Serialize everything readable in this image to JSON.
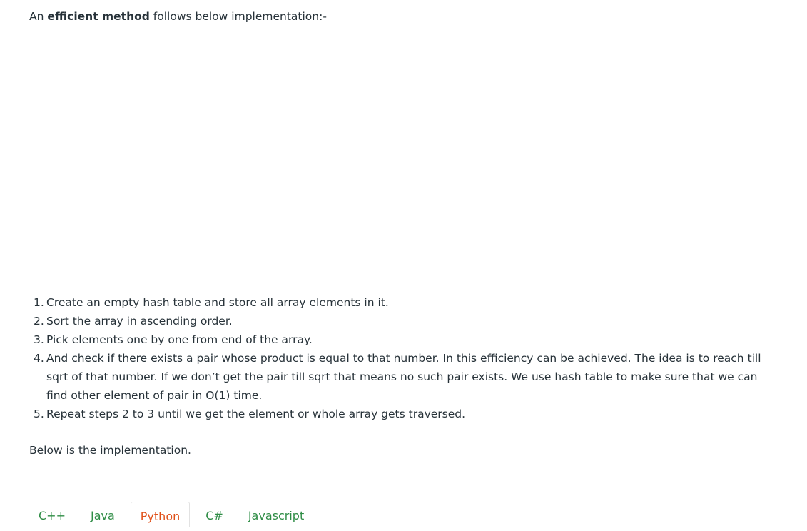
{
  "intro": {
    "prefix": "An ",
    "bold": "efficient method",
    "suffix": " follows below implementation:-"
  },
  "steps": [
    {
      "num": "1.",
      "text": "Create an empty hash table and store all array elements in it."
    },
    {
      "num": "2.",
      "text": "Sort the array in ascending order."
    },
    {
      "num": "3.",
      "text": "Pick elements one by one from end of the array."
    },
    {
      "num": "4.",
      "text": "And check if there exists a pair whose product is equal to that number. In this efficiency can be achieved. The idea is to reach till sqrt of that number. If we don’t get the pair till sqrt that means no such pair exists. We use hash table to make sure that we can find other element of pair in O(1) time."
    },
    {
      "num": "5.",
      "text": "Repeat steps 2 to 3 until we get the element or whole array gets traversed."
    }
  ],
  "below_text": "Below is the implementation.",
  "tabs": [
    {
      "label": "C++"
    },
    {
      "label": "Java"
    },
    {
      "label": "Python"
    },
    {
      "label": "C#"
    },
    {
      "label": "Javascript"
    }
  ],
  "active_tab": "Python",
  "colors": {
    "text": "#273239",
    "tab_text": "#2f8d46",
    "tab_active_text": "#e0511a",
    "tab_border": "#e2e2e2"
  }
}
